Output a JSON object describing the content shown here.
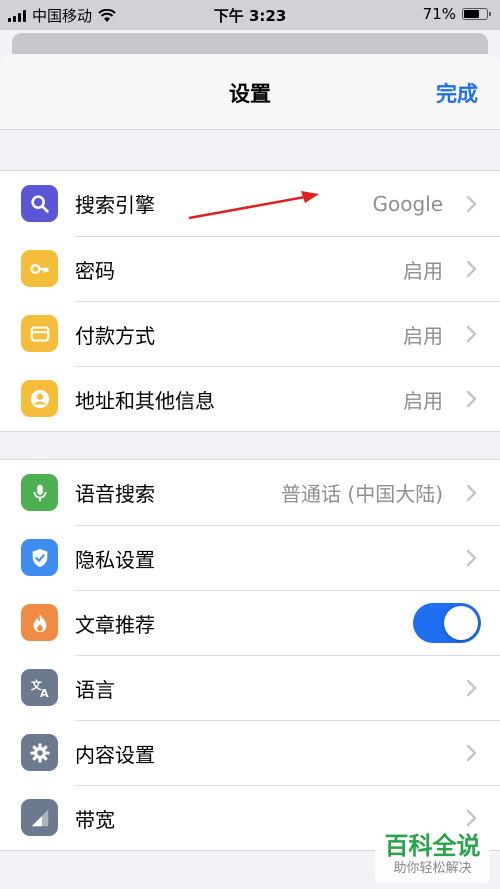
{
  "status_bar": {
    "carrier": "中国移动",
    "time": "下午 3:23",
    "battery_percent": "71%",
    "battery_level": 0.71
  },
  "nav": {
    "title": "设置",
    "done_label": "完成"
  },
  "group1": [
    {
      "label": "搜索引擎",
      "value": "Google",
      "icon": "search-icon",
      "icon_color": "#5b56d6"
    },
    {
      "label": "密码",
      "value": "启用",
      "icon": "key-icon",
      "icon_color": "#f4bd3a"
    },
    {
      "label": "付款方式",
      "value": "启用",
      "icon": "credit-card-icon",
      "icon_color": "#f4bd3a"
    },
    {
      "label": "地址和其他信息",
      "value": "启用",
      "icon": "contact-icon",
      "icon_color": "#f4bd3a"
    }
  ],
  "group2": [
    {
      "label": "语音搜索",
      "value": "普通话 (中国大陆)",
      "icon": "microphone-icon",
      "icon_color": "#4caf50"
    },
    {
      "label": "隐私设置",
      "value": "",
      "icon": "shield-check-icon",
      "icon_color": "#3f8cf0"
    },
    {
      "label": "文章推荐",
      "toggle_on": true,
      "icon": "flame-icon",
      "icon_color": "#ef8b42"
    },
    {
      "label": "语言",
      "value": "",
      "icon": "translate-icon",
      "icon_color": "#6b7a8f"
    },
    {
      "label": "内容设置",
      "value": "",
      "icon": "gear-icon",
      "icon_color": "#6b7a8f"
    },
    {
      "label": "带宽",
      "value": "",
      "icon": "bandwidth-icon",
      "icon_color": "#6b7a8f"
    }
  ],
  "colors": {
    "accent": "#1e6ef0",
    "toggle_on": "#1e6ef0",
    "annotation_arrow": "#e02020"
  },
  "watermark": {
    "main": "百科全说",
    "sub": "助你轻松解决"
  }
}
